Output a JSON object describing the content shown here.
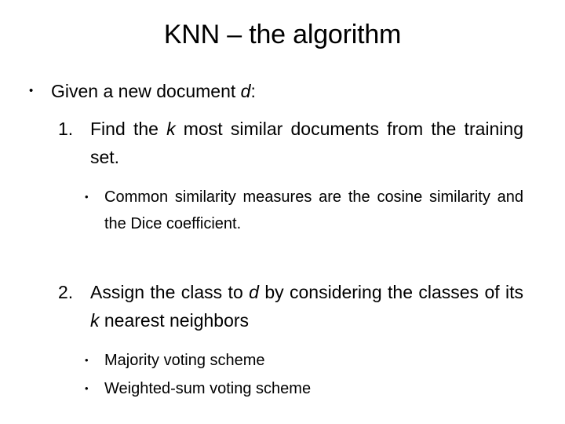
{
  "slide": {
    "title": "KNN – the algorithm",
    "background_color": "#ffffff",
    "text_color": "#000000",
    "bullet_glyph": "•",
    "content": {
      "intro": {
        "marker": "•",
        "text_before_italic": "Given a new document ",
        "italic": "d",
        "text_after_italic": ":",
        "full_text": "Given a new document d:"
      },
      "step1": {
        "marker": "1.",
        "part_a": "Find the ",
        "italic": "k",
        "part_b": " most similar documents from the training set.",
        "full_text": "Find the k most similar documents from the training set."
      },
      "step1_sub": {
        "marker": "•",
        "text": "Common similarity measures are the cosine similarity and the Dice coefficient."
      },
      "step2": {
        "marker": "2.",
        "part_a": "Assign the class to ",
        "italic_d": "d",
        "part_b": " by considering the classes of its ",
        "italic_k": "k",
        "part_c": " nearest neighbors",
        "full_text": "Assign the class to d by considering the classes of its k nearest neighbors"
      },
      "step2_sub1": {
        "marker": "•",
        "text": "Majority voting scheme"
      },
      "step2_sub2": {
        "marker": "•",
        "text": "Weighted-sum voting scheme"
      }
    }
  }
}
